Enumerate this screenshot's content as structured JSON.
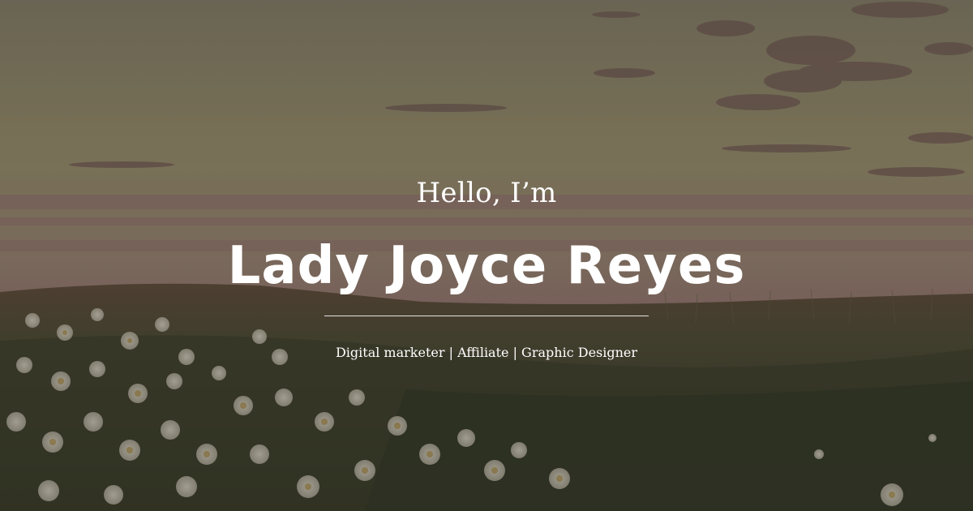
{
  "hero": {
    "greeting": "Hello, I’m",
    "name": "Lady Joyce Reyes",
    "tagline": "Digital marketer | Affiliate | Graphic Designer"
  },
  "colors": {
    "text": "#ffffff",
    "sky_top": "#8c8468",
    "sky_horizon": "#9e7a6e",
    "field": "#3b3d2c"
  }
}
